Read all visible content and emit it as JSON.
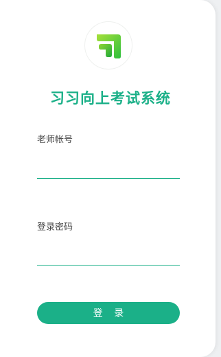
{
  "app": {
    "title": "习习向上考试系统",
    "logo_icon": "brand-logo-icon",
    "accent_color": "#1bb088"
  },
  "form": {
    "account_label": "老师帐号",
    "account_value": "",
    "password_label": "登录密码",
    "password_value": "",
    "login_label": "登 录"
  }
}
